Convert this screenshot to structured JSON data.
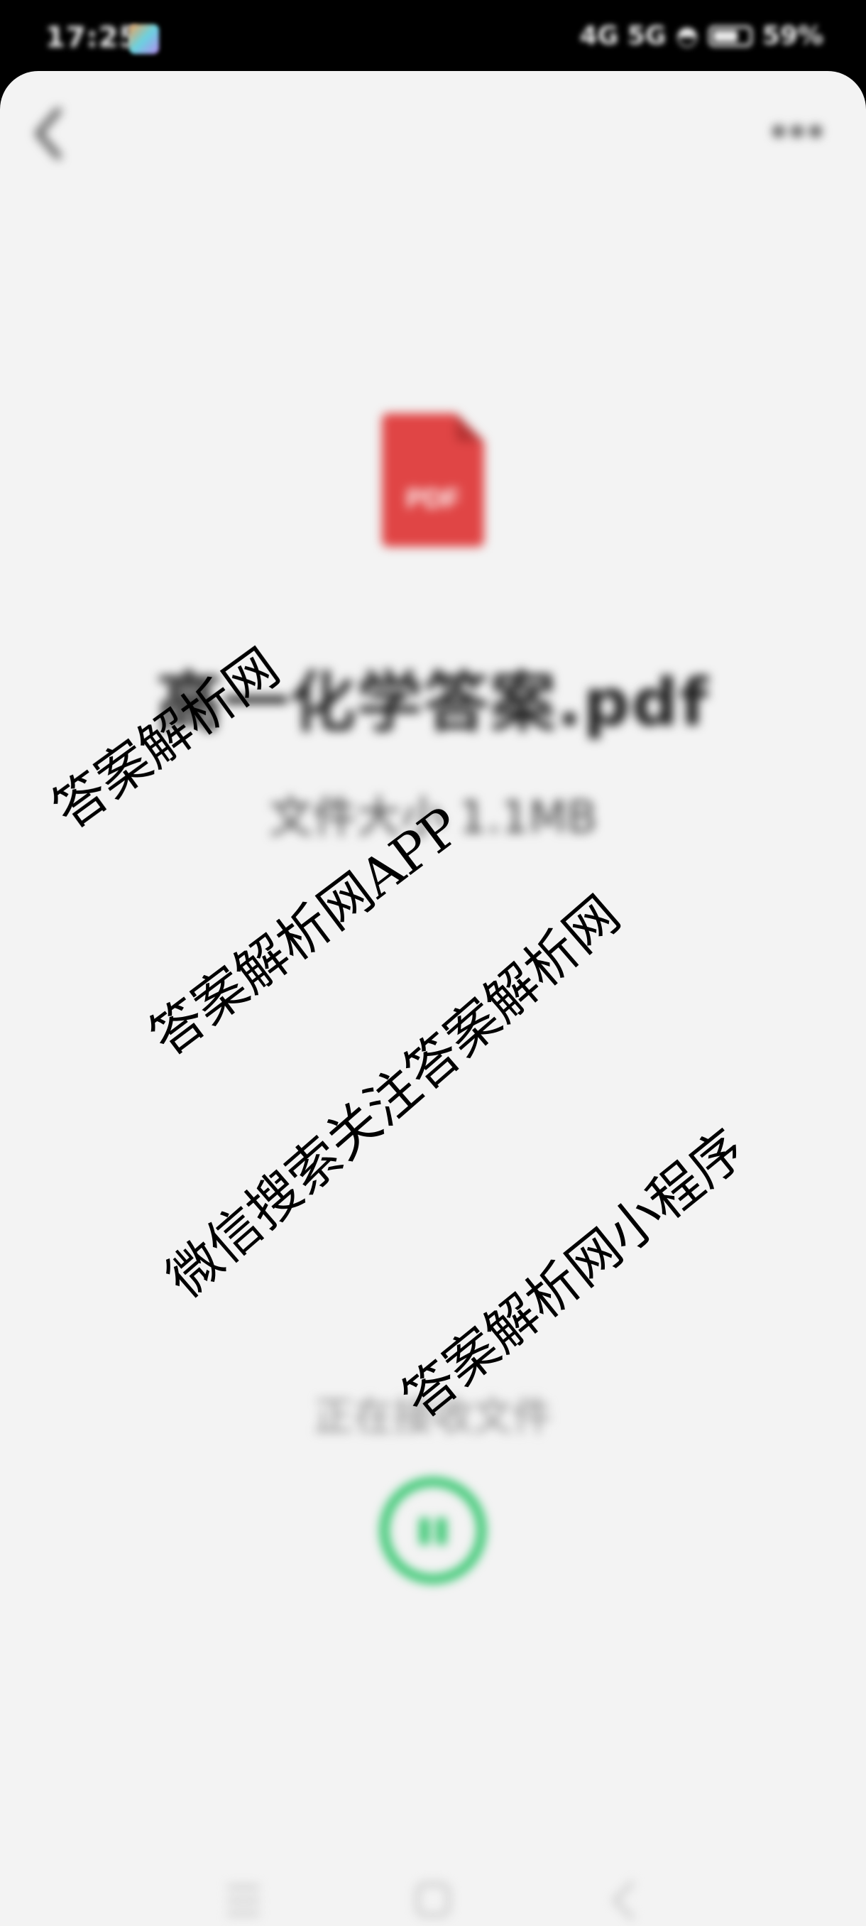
{
  "status_bar": {
    "time": "17:25",
    "app_icon": "photos-app-icon",
    "signal_text": "4G 5G",
    "battery_percent": "59%"
  },
  "header": {
    "back_icon": "chevron-left-icon",
    "more_icon": "more-dots-icon"
  },
  "file": {
    "icon_label": "PDF",
    "icon_color": "#e04545",
    "name": "高一化学答案.pdf",
    "size": "文件大小 1.1MB"
  },
  "transfer": {
    "status_text": "正在接收文件",
    "accent_color": "#2fc56b",
    "control_icon": "pause-icon"
  },
  "watermarks": [
    "答案解析网",
    "答案解析网APP",
    "微信搜索关注答案解析网",
    "答案解析网小程序"
  ],
  "nav_bar": {
    "menu_icon": "menu-icon",
    "home_icon": "home-icon",
    "back_icon": "back-icon"
  }
}
